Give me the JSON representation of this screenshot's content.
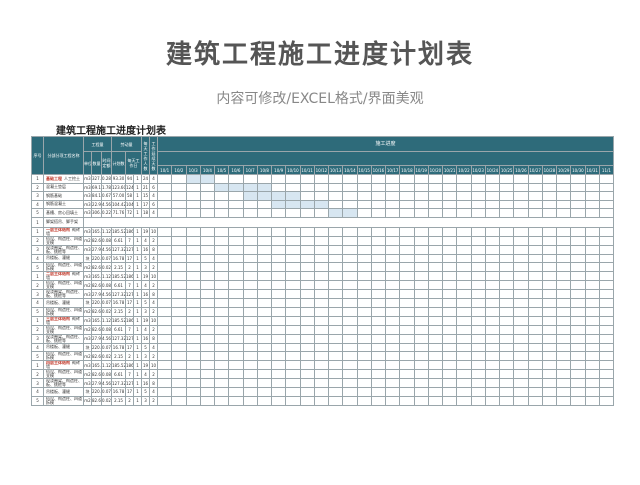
{
  "header": {
    "title": "建筑工程施工进度计划表",
    "subtitle": "内容可修改/EXCEL格式/界面美观"
  },
  "sheet": {
    "title": "建筑工程施工进度计划表",
    "columns": {
      "seq": "序号",
      "name": "分部分项工程名称",
      "quantity_group": "工程量",
      "unit": "单位",
      "amount": "数量",
      "time_quota": "时间定额",
      "labor_group": "劳动量",
      "plan": "计划数",
      "workdays": "每天工作日",
      "workers": "每天工作人数",
      "shifts": "工作延续天数",
      "schedule_group": "施工进度"
    },
    "dates": [
      "10/1",
      "10/2",
      "10/3",
      "10/4",
      "10/5",
      "10/6",
      "10/7",
      "10/8",
      "10/9",
      "10/10",
      "10/11",
      "10/12",
      "10/13",
      "10/14",
      "10/15",
      "10/16",
      "10/17",
      "10/18",
      "10/19",
      "10/20",
      "10/21",
      "10/22",
      "10/23",
      "10/24",
      "10/25",
      "10/26",
      "10/27",
      "10/28",
      "10/29",
      "10/30",
      "10/31",
      "11/1"
    ],
    "rows": [
      {
        "seq": "1",
        "cat": "基础工程",
        "name": "人工挖土",
        "unit": "m3",
        "amt": "327.5",
        "quota": "0.285",
        "plan": "93.30",
        "wd": "94",
        "ppl": "1",
        "days": "24",
        "shift": "4",
        "bar": [
          2,
          4
        ]
      },
      {
        "seq": "2",
        "cat": "",
        "name": "混凝土垫层",
        "unit": "m3",
        "amt": "69.1",
        "quota": "1.789",
        "plan": "123.60",
        "wd": "124",
        "ppl": "1",
        "days": "21",
        "shift": "6",
        "bar": [
          4,
          8
        ]
      },
      {
        "seq": "3",
        "cat": "",
        "name": "钢筋基础",
        "unit": "m3",
        "amt": "84.1",
        "quota": "0.678",
        "plan": "57.00",
        "wd": "58",
        "ppl": "1",
        "days": "15",
        "shift": "4",
        "bar": [
          6,
          10
        ]
      },
      {
        "seq": "4",
        "cat": "",
        "name": "钢筋混凝土",
        "unit": "m3",
        "amt": "22.9",
        "quota": "4.560",
        "plan": "104.42",
        "wd": "104",
        "ppl": "1",
        "days": "17",
        "shift": "6",
        "bar": [
          8,
          12
        ]
      },
      {
        "seq": "5",
        "cat": "",
        "name": "基槽、房心回填土",
        "unit": "m3",
        "amt": "306.2",
        "quota": "0.220",
        "plan": "71.76",
        "wd": "72",
        "ppl": "1",
        "days": "18",
        "shift": "4",
        "bar": [
          12,
          14
        ]
      },
      {
        "seq": "1",
        "cat": "",
        "name": "脚架搭吊、脚手架",
        "unit": "",
        "amt": "",
        "quota": "",
        "plan": "",
        "wd": "",
        "ppl": "",
        "days": "",
        "shift": "",
        "bar": null,
        "section": true
      },
      {
        "seq": "1",
        "cat": "一层主体结构",
        "name": "砌砖墙",
        "unit": "m3",
        "amt": "165.6",
        "quota": "1.120",
        "plan": "185.52",
        "wd": "186",
        "ppl": "1",
        "days": "19",
        "shift": "10",
        "bar": null
      },
      {
        "seq": "2",
        "cat": "",
        "name": "搭设、构造柱、四道支模",
        "unit": "m2",
        "amt": "82.66",
        "quota": "0.080",
        "plan": "6.61",
        "wd": "7",
        "ppl": "1",
        "days": "4",
        "shift": "2",
        "bar": null
      },
      {
        "seq": "3",
        "cat": "",
        "name": "现浇圈梁、构造柱、板、挑檐等",
        "unit": "m3",
        "amt": "27.92",
        "quota": "4.560",
        "plan": "127.32",
        "wd": "127",
        "ppl": "1",
        "days": "16",
        "shift": "8",
        "bar": null
      },
      {
        "seq": "4",
        "cat": "",
        "name": "吊楼板、灌缝",
        "unit": "块",
        "amt": "220.8",
        "quota": "0.076",
        "plan": "16.78",
        "wd": "17",
        "ppl": "1",
        "days": "5",
        "shift": "4",
        "bar": null
      },
      {
        "seq": "5",
        "cat": "",
        "name": "搭设、构造柱、四道拆模",
        "unit": "m2",
        "amt": "82.66",
        "quota": "0.026",
        "plan": "2.15",
        "wd": "2",
        "ppl": "1",
        "days": "3",
        "shift": "2",
        "bar": null
      },
      {
        "seq": "1",
        "cat": "二层主体结构",
        "name": "砌砖墙",
        "unit": "m3",
        "amt": "165.6",
        "quota": "1.120",
        "plan": "185.52",
        "wd": "186",
        "ppl": "1",
        "days": "19",
        "shift": "10",
        "bar": null
      },
      {
        "seq": "2",
        "cat": "",
        "name": "搭设、构造柱、四道支模",
        "unit": "m2",
        "amt": "82.66",
        "quota": "0.080",
        "plan": "6.61",
        "wd": "7",
        "ppl": "1",
        "days": "4",
        "shift": "2",
        "bar": null
      },
      {
        "seq": "3",
        "cat": "",
        "name": "现浇圈梁、构造柱、板、挑檐等",
        "unit": "m3",
        "amt": "27.92",
        "quota": "4.560",
        "plan": "127.32",
        "wd": "127",
        "ppl": "1",
        "days": "16",
        "shift": "8",
        "bar": null
      },
      {
        "seq": "4",
        "cat": "",
        "name": "吊楼板、灌缝",
        "unit": "块",
        "amt": "220.8",
        "quota": "0.076",
        "plan": "16.78",
        "wd": "17",
        "ppl": "1",
        "days": "5",
        "shift": "4",
        "bar": null
      },
      {
        "seq": "5",
        "cat": "",
        "name": "搭设、构造柱、四道拆模",
        "unit": "m2",
        "amt": "82.66",
        "quota": "0.026",
        "plan": "2.15",
        "wd": "2",
        "ppl": "1",
        "days": "3",
        "shift": "2",
        "bar": null
      },
      {
        "seq": "1",
        "cat": "三层主体结构",
        "name": "砌砖墙",
        "unit": "m3",
        "amt": "165.6",
        "quota": "1.120",
        "plan": "185.52",
        "wd": "186",
        "ppl": "1",
        "days": "19",
        "shift": "10",
        "bar": null
      },
      {
        "seq": "2",
        "cat": "",
        "name": "搭设、构造柱、四道支模",
        "unit": "m2",
        "amt": "82.66",
        "quota": "0.080",
        "plan": "6.61",
        "wd": "7",
        "ppl": "1",
        "days": "4",
        "shift": "2",
        "bar": null
      },
      {
        "seq": "3",
        "cat": "",
        "name": "现浇圈梁、构造柱、板、挑檐等",
        "unit": "m3",
        "amt": "27.92",
        "quota": "4.560",
        "plan": "127.32",
        "wd": "127",
        "ppl": "1",
        "days": "16",
        "shift": "8",
        "bar": null
      },
      {
        "seq": "4",
        "cat": "",
        "name": "吊楼板、灌缝",
        "unit": "块",
        "amt": "220.8",
        "quota": "0.076",
        "plan": "16.78",
        "wd": "17",
        "ppl": "1",
        "days": "5",
        "shift": "4",
        "bar": null
      },
      {
        "seq": "5",
        "cat": "",
        "name": "搭设、构造柱、四道拆模",
        "unit": "m2",
        "amt": "82.66",
        "quota": "0.026",
        "plan": "2.15",
        "wd": "2",
        "ppl": "1",
        "days": "3",
        "shift": "2",
        "bar": null
      },
      {
        "seq": "1",
        "cat": "四层主体结构",
        "name": "砌砖墙",
        "unit": "m3",
        "amt": "165.6",
        "quota": "1.120",
        "plan": "185.52",
        "wd": "186",
        "ppl": "1",
        "days": "19",
        "shift": "10",
        "bar": null
      },
      {
        "seq": "2",
        "cat": "",
        "name": "搭设、构造柱、四道支模",
        "unit": "m2",
        "amt": "82.66",
        "quota": "0.080",
        "plan": "6.61",
        "wd": "7",
        "ppl": "1",
        "days": "4",
        "shift": "2",
        "bar": null
      },
      {
        "seq": "3",
        "cat": "",
        "name": "现浇圈梁、构造柱、板、挑檐等",
        "unit": "m3",
        "amt": "27.92",
        "quota": "4.560",
        "plan": "127.32",
        "wd": "127",
        "ppl": "1",
        "days": "16",
        "shift": "8",
        "bar": null
      },
      {
        "seq": "4",
        "cat": "",
        "name": "吊楼板、灌缝",
        "unit": "块",
        "amt": "220.8",
        "quota": "0.076",
        "plan": "16.78",
        "wd": "17",
        "ppl": "1",
        "days": "5",
        "shift": "4",
        "bar": null
      },
      {
        "seq": "5",
        "cat": "",
        "name": "搭设、构造柱、四道拆模",
        "unit": "m2",
        "amt": "82.66",
        "quota": "0.026",
        "plan": "2.15",
        "wd": "2",
        "ppl": "1",
        "days": "3",
        "shift": "2",
        "bar": null
      }
    ]
  }
}
